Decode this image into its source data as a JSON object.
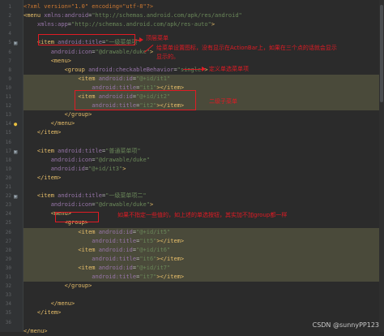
{
  "editor": {
    "line_numbers": [
      "1",
      "2",
      "3",
      "4",
      "5",
      "6",
      "7",
      "8",
      "9",
      "10",
      "11",
      "12",
      "13",
      "14",
      "15",
      "16",
      "17",
      "18",
      "19",
      "20",
      "21",
      "22",
      "23",
      "24",
      "25",
      "26",
      "27",
      "28",
      "29",
      "30",
      "31",
      "32",
      "33",
      "34",
      "35",
      "36"
    ],
    "lines": [
      [
        {
          "c": "t-pi",
          "t": "<?xml version=\"1.0\" encoding=\"utf-8\"?>"
        }
      ],
      [
        {
          "c": "t-tag",
          "t": "<menu "
        },
        {
          "c": "t-ns",
          "t": "xmlns:android"
        },
        {
          "c": "t-attr",
          "t": "="
        },
        {
          "c": "t-val",
          "t": "\"http://schemas.android.com/apk/res/android\""
        }
      ],
      [
        {
          "c": "t-attr",
          "t": "    "
        },
        {
          "c": "t-ns",
          "t": "xmlns:app"
        },
        {
          "c": "t-attr",
          "t": "="
        },
        {
          "c": "t-val",
          "t": "\"http://schemas.android.com/apk/res-auto\""
        },
        {
          "c": "t-tag",
          "t": ">"
        }
      ],
      [],
      [
        {
          "c": "t-tag",
          "t": "    <item "
        },
        {
          "c": "t-ns",
          "t": "android:title"
        },
        {
          "c": "t-attr",
          "t": "="
        },
        {
          "c": "t-val",
          "t": "\"一级菜单项\""
        }
      ],
      [
        {
          "c": "t-attr",
          "t": "        "
        },
        {
          "c": "t-ns",
          "t": "android:icon"
        },
        {
          "c": "t-attr",
          "t": "="
        },
        {
          "c": "t-val",
          "t": "\"@drawable/duke\""
        },
        {
          "c": "t-tag",
          "t": ">"
        }
      ],
      [
        {
          "c": "t-tag",
          "t": "        <menu>"
        }
      ],
      [
        {
          "c": "t-tag",
          "t": "            <group "
        },
        {
          "c": "t-ns",
          "t": "android:checkableBehavior"
        },
        {
          "c": "t-attr",
          "t": "="
        },
        {
          "c": "t-val",
          "t": "\"single\""
        },
        {
          "c": "t-tag",
          "t": ">"
        }
      ],
      [
        {
          "c": "t-tag",
          "t": "                <item "
        },
        {
          "c": "t-ns",
          "t": "android:id"
        },
        {
          "c": "t-attr",
          "t": "="
        },
        {
          "c": "t-val",
          "t": "\"@+id/it1\""
        }
      ],
      [
        {
          "c": "t-attr",
          "t": "                    "
        },
        {
          "c": "t-ns",
          "t": "android:title"
        },
        {
          "c": "t-attr",
          "t": "="
        },
        {
          "c": "t-val",
          "t": "\"it1\""
        },
        {
          "c": "t-tag",
          "t": "></item>"
        }
      ],
      [
        {
          "c": "t-tag",
          "t": "                <item "
        },
        {
          "c": "t-ns",
          "t": "android:id"
        },
        {
          "c": "t-attr",
          "t": "="
        },
        {
          "c": "t-val",
          "t": "\"@+id/it2\""
        }
      ],
      [
        {
          "c": "t-attr",
          "t": "                    "
        },
        {
          "c": "t-ns",
          "t": "android:title"
        },
        {
          "c": "t-attr",
          "t": "="
        },
        {
          "c": "t-val",
          "t": "\"it2\""
        },
        {
          "c": "t-tag",
          "t": "></item>"
        }
      ],
      [
        {
          "c": "t-tag",
          "t": "            </group>"
        }
      ],
      [
        {
          "c": "t-tag",
          "t": "        </menu>"
        }
      ],
      [
        {
          "c": "t-tag",
          "t": "    </item>"
        }
      ],
      [],
      [
        {
          "c": "t-tag",
          "t": "    <item "
        },
        {
          "c": "t-ns",
          "t": "android:title"
        },
        {
          "c": "t-attr",
          "t": "="
        },
        {
          "c": "t-val",
          "t": "\"普通菜单项\""
        }
      ],
      [
        {
          "c": "t-attr",
          "t": "        "
        },
        {
          "c": "t-ns",
          "t": "android:icon"
        },
        {
          "c": "t-attr",
          "t": "="
        },
        {
          "c": "t-val",
          "t": "\"@drawable/duke\""
        }
      ],
      [
        {
          "c": "t-attr",
          "t": "        "
        },
        {
          "c": "t-ns",
          "t": "android:id"
        },
        {
          "c": "t-attr",
          "t": "="
        },
        {
          "c": "t-val",
          "t": "\"@+id/it3\""
        },
        {
          "c": "t-tag",
          "t": ">"
        }
      ],
      [
        {
          "c": "t-tag",
          "t": "    </item>"
        }
      ],
      [],
      [
        {
          "c": "t-tag",
          "t": "    <item "
        },
        {
          "c": "t-ns",
          "t": "android:title"
        },
        {
          "c": "t-attr",
          "t": "="
        },
        {
          "c": "t-val",
          "t": "\"一级菜单项二\""
        }
      ],
      [
        {
          "c": "t-attr",
          "t": "        "
        },
        {
          "c": "t-ns",
          "t": "android:icon"
        },
        {
          "c": "t-attr",
          "t": "="
        },
        {
          "c": "t-val",
          "t": "\"@drawable/duke\""
        },
        {
          "c": "t-tag",
          "t": ">"
        }
      ],
      [
        {
          "c": "t-tag",
          "t": "        <menu>"
        }
      ],
      [
        {
          "c": "t-tag",
          "t": "            <group>"
        }
      ],
      [
        {
          "c": "t-tag",
          "t": "                <item "
        },
        {
          "c": "t-ns",
          "t": "android:id"
        },
        {
          "c": "t-attr",
          "t": "="
        },
        {
          "c": "t-val",
          "t": "\"@+id/it5\""
        }
      ],
      [
        {
          "c": "t-attr",
          "t": "                    "
        },
        {
          "c": "t-ns",
          "t": "android:title"
        },
        {
          "c": "t-attr",
          "t": "="
        },
        {
          "c": "t-val",
          "t": "\"it5\""
        },
        {
          "c": "t-tag",
          "t": "></item>"
        }
      ],
      [
        {
          "c": "t-tag",
          "t": "                <item "
        },
        {
          "c": "t-ns",
          "t": "android:id"
        },
        {
          "c": "t-attr",
          "t": "="
        },
        {
          "c": "t-val",
          "t": "\"@+id/it6\""
        }
      ],
      [
        {
          "c": "t-attr",
          "t": "                    "
        },
        {
          "c": "t-ns",
          "t": "android:title"
        },
        {
          "c": "t-attr",
          "t": "="
        },
        {
          "c": "t-val",
          "t": "\"it6\""
        },
        {
          "c": "t-tag",
          "t": "></item>"
        }
      ],
      [
        {
          "c": "t-tag",
          "t": "                <item "
        },
        {
          "c": "t-ns",
          "t": "android:id"
        },
        {
          "c": "t-attr",
          "t": "="
        },
        {
          "c": "t-val",
          "t": "\"@+id/it7\""
        }
      ],
      [
        {
          "c": "t-attr",
          "t": "                    "
        },
        {
          "c": "t-ns",
          "t": "android:title"
        },
        {
          "c": "t-attr",
          "t": "="
        },
        {
          "c": "t-val",
          "t": "\"it7\""
        },
        {
          "c": "t-tag",
          "t": "></item>"
        }
      ],
      [
        {
          "c": "t-tag",
          "t": "            </group>"
        }
      ],
      [],
      [
        {
          "c": "t-tag",
          "t": "        </menu>"
        }
      ],
      [
        {
          "c": "t-tag",
          "t": "    </item>"
        }
      ],
      [],
      [
        {
          "c": "t-tag",
          "t": "</menu>"
        }
      ]
    ]
  },
  "annotations": {
    "top_menu": "顶层菜单",
    "icon_note_1": "给菜单设置图标，没有显示在ActionBar上，如果在三个点的话就会显示",
    "icon_note_2": "显示的。",
    "single_choice": "定义单选菜单项",
    "submenu": "二级子菜单",
    "group_note": "如果不指定一些值的，如上述的单选按钮，其实加不加group都一样"
  },
  "watermark": "CSDN @sunnyPP123",
  "colors": {
    "background": "#2b2b2b",
    "annotation_red": "#e01b24",
    "tag": "#e8bf6a",
    "value": "#6a8759",
    "namespace_attr": "#9876aa"
  }
}
